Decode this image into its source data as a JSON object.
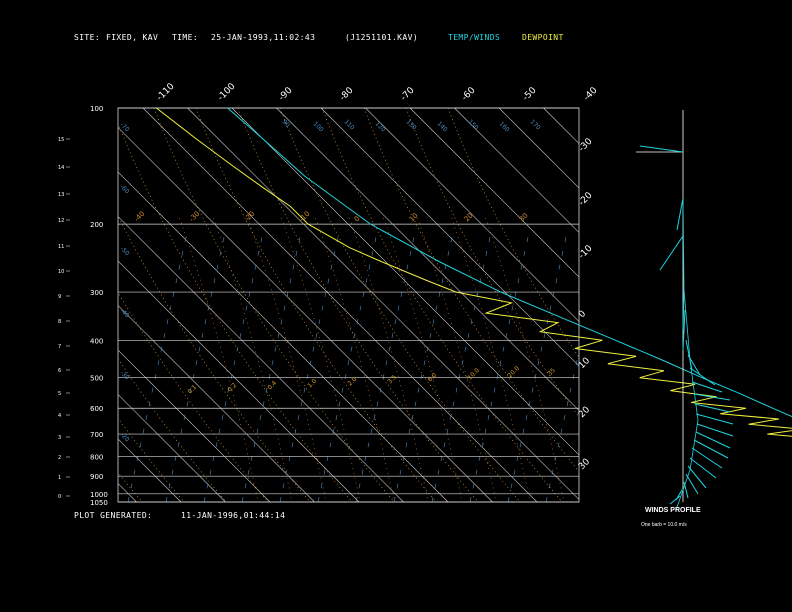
{
  "header": {
    "site_label": "SITE:",
    "site_value": "FIXED, KAV",
    "time_label": "TIME:",
    "time_value": "25-JAN-1993,11:02:43",
    "file_id": "(J1251101.KAV)",
    "temp_winds": "TEMP/WINDS",
    "dewpoint": "DEWPOINT"
  },
  "footer": {
    "generated_label": "PLOT GENERATED:",
    "generated_value": "11-JAN-1996,01:44:14"
  },
  "winds_profile": {
    "title": "WINDS PROFILE",
    "note": "One barb = 10.0 m/s"
  },
  "colors": {
    "temperature": "#1fd4e0",
    "dewpoint": "#f0f040",
    "grid": "#d8d8d8",
    "dry_adiabat": "#d8a030",
    "moist_adiabat": "#d08830",
    "mixing_ratio": "#4a90c8"
  },
  "chart_data": {
    "type": "line",
    "subtype": "skew-T log-P sounding",
    "pressure_levels_hPa": [
      100,
      200,
      300,
      400,
      500,
      600,
      700,
      800,
      900,
      1000,
      1050
    ],
    "height_ticks_km": [
      "0",
      "1",
      "2",
      "3",
      "4",
      "5",
      "6",
      "7",
      "8",
      "9",
      "10",
      "11",
      "12",
      "13",
      "14",
      "15"
    ],
    "top_temp_labels": [
      "-110",
      "-100",
      "-90",
      "-80",
      "-70",
      "-60",
      "-50",
      "-40"
    ],
    "right_temp_labels": [
      "-30",
      "-20",
      "-10",
      "0",
      "10",
      "20",
      "30"
    ],
    "mixing_ratio_labels": [
      "0.1",
      "0.2",
      "0.4",
      "1.0",
      "2.0",
      "3.5",
      "6.0",
      "10.0",
      "20.0",
      "35"
    ],
    "theta_top_labels": [
      "90",
      "100",
      "110",
      "120",
      "130",
      "140",
      "150",
      "160",
      "170"
    ],
    "theta_left_labels": [
      "-70",
      "-60",
      "-50",
      "-40",
      "-30",
      "-20"
    ],
    "series": [
      {
        "name": "TEMP/WINDS",
        "p": [
          1000,
          950,
          900,
          850,
          800,
          750,
          700,
          650,
          600,
          550,
          500,
          450,
          400,
          350,
          300,
          250,
          200,
          150,
          120,
          100
        ],
        "t": [
          4,
          3,
          2,
          0,
          -3,
          -6,
          -9,
          -13,
          -17,
          -21,
          -26,
          -31,
          -37,
          -44,
          -52,
          -59,
          -66,
          -70,
          -71,
          -72
        ]
      },
      {
        "name": "DEWPOINT",
        "p": [
          1000,
          960,
          930,
          900,
          870,
          840,
          800,
          780,
          760,
          740,
          720,
          700,
          680,
          660,
          640,
          620,
          600,
          580,
          560,
          540,
          520,
          500,
          480,
          460,
          440,
          420,
          400,
          380,
          360,
          340,
          320,
          300,
          280,
          250,
          230,
          200,
          180,
          160,
          140,
          120,
          100
        ],
        "t": [
          -5,
          -2,
          -4,
          -7,
          -4,
          -10,
          -6,
          -12,
          -8,
          -20,
          -13,
          -24,
          -15,
          -26,
          -18,
          -30,
          -23,
          -34,
          -27,
          -36,
          -29,
          -40,
          -33,
          -44,
          -36,
          -48,
          -40,
          -52,
          -46,
          -60,
          -52,
          -62,
          -66,
          -72,
          -76,
          -80,
          -80,
          -82,
          -84,
          -86,
          -88
        ]
      }
    ],
    "winds_barbs_count": 22
  }
}
